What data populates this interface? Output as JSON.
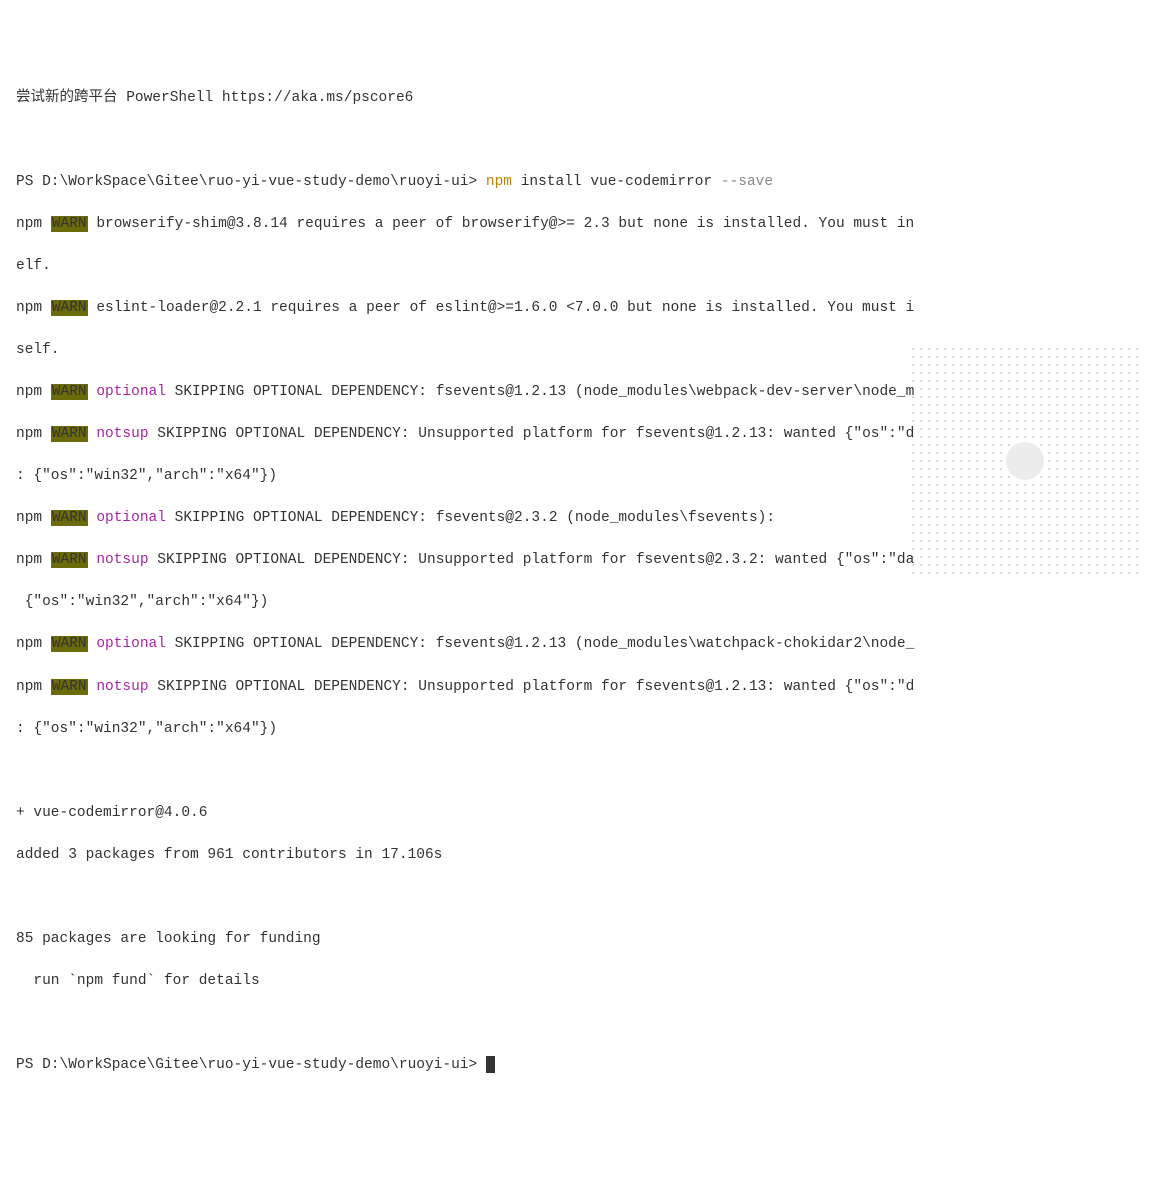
{
  "header_line": "尝试新的跨平台 PowerShell https://aka.ms/pscore6",
  "prompt_prefix": "PS D:\\WorkSpace\\Gitee\\ruo-yi-vue-study-demo\\ruoyi-ui> ",
  "command_yellow": "npm",
  "command_rest": " install vue-codemirror ",
  "command_gray": "--save",
  "warn_prefix": "npm ",
  "warn_tag": "WARN",
  "warn1_text": " browserify-shim@3.8.14 requires a peer of browserify@>= 2.3 but none is installed. You must in",
  "warn1_cont": "elf.",
  "warn2_text": " eslint-loader@2.2.1 requires a peer of eslint@>=1.6.0 <7.0.0 but none is installed. You must i",
  "warn2_cont": "self.",
  "optional_tag": " optional",
  "notsup_tag": " notsup",
  "warn3_text": " SKIPPING OPTIONAL DEPENDENCY: fsevents@1.2.13 (node_modules\\webpack-dev-server\\node_m",
  "warn4_text": " SKIPPING OPTIONAL DEPENDENCY: Unsupported platform for fsevents@1.2.13: wanted {\"os\":\"d",
  "warn4_cont": ": {\"os\":\"win32\",\"arch\":\"x64\"})",
  "warn5_text": " SKIPPING OPTIONAL DEPENDENCY: fsevents@2.3.2 (node_modules\\fsevents):",
  "warn6_text": " SKIPPING OPTIONAL DEPENDENCY: Unsupported platform for fsevents@2.3.2: wanted {\"os\":\"da",
  "warn6_cont": " {\"os\":\"win32\",\"arch\":\"x64\"})",
  "warn7_text": " SKIPPING OPTIONAL DEPENDENCY: fsevents@1.2.13 (node_modules\\watchpack-chokidar2\\node_",
  "warn8_text": " SKIPPING OPTIONAL DEPENDENCY: Unsupported platform for fsevents@1.2.13: wanted {\"os\":\"d",
  "warn8_cont": ": {\"os\":\"win32\",\"arch\":\"x64\"})",
  "install_result": "+ vue-codemirror@4.0.6",
  "added_line": "added 3 packages from 961 contributors in 17.106s",
  "funding_line1": "85 packages are looking for funding",
  "funding_line2": "  run `npm fund` for details",
  "final_prompt": "PS D:\\WorkSpace\\Gitee\\ruo-yi-vue-study-demo\\ruoyi-ui> "
}
